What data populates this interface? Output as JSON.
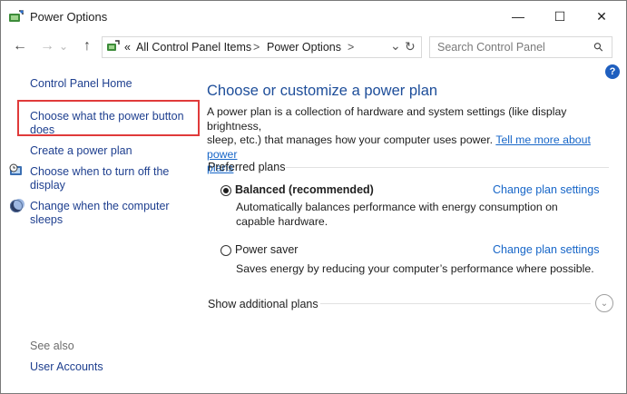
{
  "window": {
    "title": "Power Options",
    "minimize_glyph": "—",
    "maximize_glyph": "☐",
    "close_glyph": "✕"
  },
  "nav": {
    "back_glyph": "←",
    "forward_glyph": "→",
    "dropdown_glyph": "⌄",
    "up_glyph": "↑"
  },
  "address": {
    "separator": "«",
    "crumb1": "All Control Panel Items",
    "arrow1": ">",
    "crumb2": "Power Options",
    "arrow2": ">",
    "dropdown_glyph": "⌄",
    "refresh_glyph": "↻"
  },
  "search": {
    "placeholder": "Search Control Panel",
    "icon": "⚲"
  },
  "help": {
    "glyph": "?"
  },
  "sidebar": {
    "home": "Control Panel Home",
    "power_button_line1": "Choose what the power button",
    "power_button_line2": "does",
    "create_plan": "Create a power plan",
    "turn_off_display_line1": "Choose when to turn off the",
    "turn_off_display_line2": "display",
    "sleep_line1": "Change when the computer",
    "sleep_line2": "sleeps",
    "see_also": "See also",
    "user_accounts": "User Accounts"
  },
  "main": {
    "heading": "Choose or customize a power plan",
    "intro_line1": "A power plan is a collection of hardware and system settings (like display brightness,",
    "intro_line2_text": "sleep, etc.) that manages how your computer uses power.",
    "intro_link_part1": "Tell me more about power",
    "intro_link_part2": "plans",
    "preferred_plans": "Preferred plans",
    "plans": [
      {
        "name": "Balanced (recommended)",
        "selected": true,
        "change_link": "Change plan settings",
        "desc_line1": "Automatically balances performance with energy consumption on",
        "desc_line2": "capable hardware."
      },
      {
        "name": "Power saver",
        "selected": false,
        "change_link": "Change plan settings",
        "desc_line1": "Saves energy by reducing your computer’s performance where possible.",
        "desc_line2": ""
      }
    ],
    "show_additional": "Show additional plans",
    "expand_glyph": "⌄"
  },
  "colors": {
    "link": "#1766c8",
    "heading": "#1e4e9a",
    "highlight_border": "#e03a3a"
  }
}
